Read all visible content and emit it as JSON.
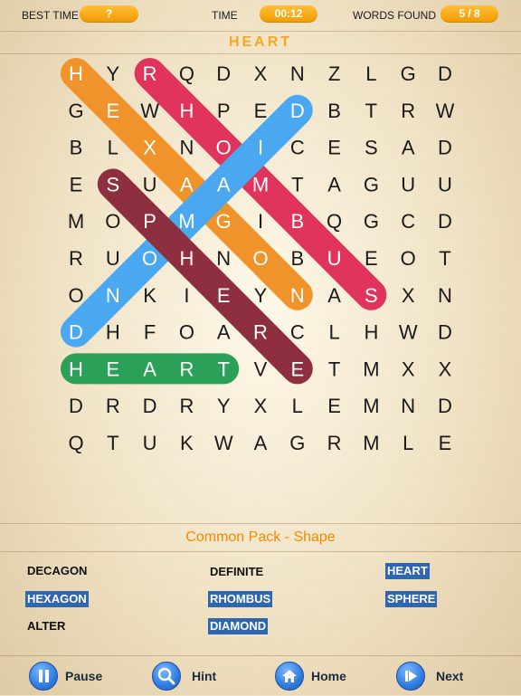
{
  "header": {
    "best_time_label": "BEST TIME",
    "best_time_value": "?",
    "time_label": "TIME",
    "time_value": "00:12",
    "words_found_label": "WORDS FOUND",
    "words_found_value": "5 / 8"
  },
  "current_word": "HEART",
  "grid": [
    [
      "H",
      "Y",
      "R",
      "Q",
      "D",
      "X",
      "N",
      "Z",
      "L",
      "G",
      "D"
    ],
    [
      "G",
      "E",
      "W",
      "H",
      "P",
      "E",
      "D",
      "B",
      "T",
      "R",
      "W"
    ],
    [
      "B",
      "L",
      "X",
      "N",
      "O",
      "I",
      "C",
      "E",
      "S",
      "A",
      "D"
    ],
    [
      "E",
      "S",
      "U",
      "A",
      "A",
      "M",
      "T",
      "A",
      "G",
      "U",
      "U"
    ],
    [
      "M",
      "O",
      "P",
      "M",
      "G",
      "I",
      "B",
      "Q",
      "G",
      "C",
      "D"
    ],
    [
      "R",
      "U",
      "O",
      "H",
      "N",
      "O",
      "B",
      "U",
      "E",
      "O",
      "T"
    ],
    [
      "O",
      "N",
      "K",
      "I",
      "E",
      "Y",
      "N",
      "A",
      "S",
      "X",
      "N"
    ],
    [
      "D",
      "H",
      "F",
      "O",
      "A",
      "R",
      "C",
      "L",
      "H",
      "W",
      "D"
    ],
    [
      "H",
      "E",
      "A",
      "R",
      "T",
      "V",
      "E",
      "T",
      "M",
      "X",
      "X"
    ],
    [
      "D",
      "R",
      "D",
      "R",
      "Y",
      "X",
      "L",
      "E",
      "M",
      "N",
      "D"
    ],
    [
      "Q",
      "T",
      "U",
      "K",
      "W",
      "A",
      "G",
      "R",
      "M",
      "L",
      "E"
    ]
  ],
  "found_words": [
    {
      "word": "HEXAGON",
      "color": "#f0932b",
      "start": [
        0,
        0
      ],
      "end": [
        6,
        6
      ]
    },
    {
      "word": "RHOMBUS",
      "color": "#e0345c",
      "start": [
        0,
        2
      ],
      "end": [
        6,
        8
      ]
    },
    {
      "word": "DIAMOND",
      "color": "#4aa8f0",
      "start": [
        1,
        6
      ],
      "end": [
        7,
        0
      ]
    },
    {
      "word": "SPHERE",
      "color": "#8e2f3f",
      "start": [
        3,
        1
      ],
      "end": [
        8,
        6
      ]
    },
    {
      "word": "HEART",
      "color": "#2aa058",
      "start": [
        8,
        0
      ],
      "end": [
        8,
        4
      ]
    }
  ],
  "pack_title": "Common Pack - Shape",
  "words": [
    {
      "text": "DECAGON",
      "found": false
    },
    {
      "text": "DEFINITE",
      "found": false
    },
    {
      "text": "HEART",
      "found": true
    },
    {
      "text": "HEXAGON",
      "found": true
    },
    {
      "text": "RHOMBUS",
      "found": true
    },
    {
      "text": "SPHERE",
      "found": true
    },
    {
      "text": "ALTER",
      "found": false
    },
    {
      "text": "DIAMOND",
      "found": true
    }
  ],
  "buttons": {
    "pause": "Pause",
    "hint": "Hint",
    "home": "Home",
    "next": "Next"
  },
  "colors": {
    "accent": "#f29a00",
    "found_word_bg": "#2f66b0",
    "button_blue": "#2f7de0"
  },
  "icons": {
    "pause": "pause-icon",
    "hint": "magnifier-icon",
    "home": "home-icon",
    "next": "skip-next-icon"
  }
}
